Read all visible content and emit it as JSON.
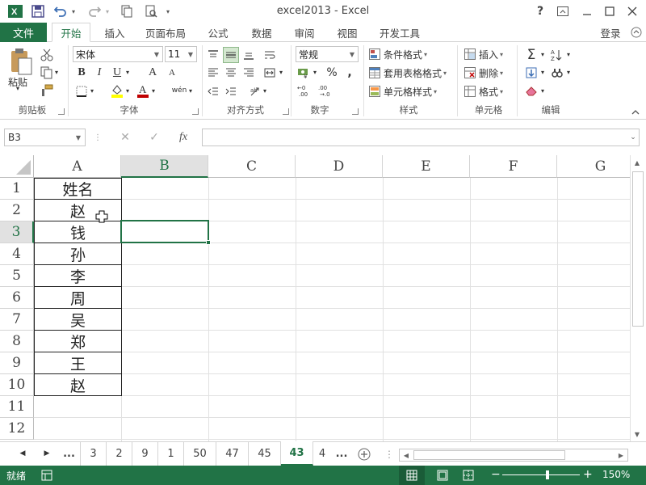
{
  "app": {
    "title": "excel2013 - Excel",
    "logo_letter": "X",
    "help": "?",
    "login": "登录"
  },
  "tabs": {
    "file": "文件",
    "items": [
      "开始",
      "插入",
      "页面布局",
      "公式",
      "数据",
      "审阅",
      "视图",
      "开发工具"
    ],
    "active": "开始"
  },
  "ribbon": {
    "clipboard": {
      "label": "剪贴板",
      "paste": "粘贴"
    },
    "font": {
      "label": "字体",
      "name": "宋体",
      "size": "11",
      "bold": "B",
      "italic": "I",
      "underline": "U",
      "grow": "A",
      "shrink": "A",
      "phonetic": "wén"
    },
    "alignment": {
      "label": "对齐方式"
    },
    "number": {
      "label": "数字",
      "format": "常规",
      "percent": "%"
    },
    "styles": {
      "label": "样式",
      "conditional": "条件格式",
      "table": "套用表格格式",
      "cell_styles": "单元格样式"
    },
    "cells": {
      "label": "单元格",
      "insert": "插入",
      "delete": "删除",
      "format": "格式"
    },
    "editing": {
      "label": "编辑"
    },
    "colors": {
      "font_red": "#c00000",
      "fill_yellow": "#ffff00"
    }
  },
  "formula_bar": {
    "name_box": "B3",
    "cancel": "✕",
    "enter": "✓",
    "fx": "fx",
    "value": ""
  },
  "sheet": {
    "columns": [
      "A",
      "B",
      "C",
      "D",
      "E",
      "F",
      "G"
    ],
    "selected_column": "B",
    "rows": [
      "1",
      "2",
      "3",
      "4",
      "5",
      "6",
      "7",
      "8",
      "9",
      "10",
      "11",
      "12"
    ],
    "selected_row": "3",
    "column_a_values": [
      "姓名",
      "赵",
      "钱",
      "孙",
      "李",
      "周",
      "吴",
      "郑",
      "王",
      "赵"
    ],
    "active_cell": "B3"
  },
  "sheet_tabs": {
    "ellipsis": "...",
    "items": [
      "3",
      "2",
      "9",
      "1",
      "50",
      "47",
      "45",
      "43",
      "4"
    ],
    "active": "43",
    "more": "..."
  },
  "status": {
    "ready": "就绪",
    "zoom": "150%",
    "zoom_minus": "−",
    "zoom_plus": "+"
  },
  "theme": {
    "accent": "#217346"
  }
}
